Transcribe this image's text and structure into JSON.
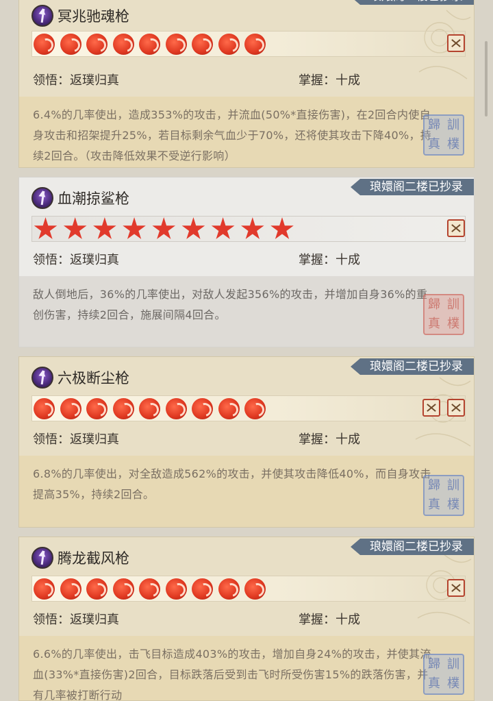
{
  "common": {
    "tag": "琅嬛阁二楼已抄录",
    "comprehension_label": "领悟：",
    "comprehension_value": "返璞归真",
    "mastery_label": "掌握：",
    "mastery_value": "十成",
    "seal_chars": [
      "歸",
      "訓",
      "真",
      "樸"
    ]
  },
  "skills": [
    {
      "name": "冥兆驰魂枪",
      "mark_type": "flame",
      "rating": 9,
      "description": "6.4%的几率使出，造成353%的攻击，并流血(50%*直接伤害)，在2回合内使自身攻击和招架提升25%，若目标剩余气血少于70%，还将使其攻击下降40%，持续2回合。（攻击降低效果不受逆行影响）"
    },
    {
      "name": "血潮掠鲨枪",
      "mark_type": "star",
      "rating": 9,
      "description": "敌人倒地后，36%的几率使出，对敌人发起356%的攻击，并增加自身36%的重创伤害，持续2回合，施展间隔4回合。"
    },
    {
      "name": "六极断尘枪",
      "mark_type": "flame",
      "rating": 9,
      "description": "6.8%的几率使出，对全敌造成562%的攻击，并使其攻击降低40%，而自身攻击提高35%，持续2回合。"
    },
    {
      "name": "腾龙截风枪",
      "mark_type": "flame",
      "rating": 9,
      "description": "6.6%的几率使出，击飞目标造成403%的攻击，增加自身24%的攻击，并使其流血(33%*直接伤害)2回合，目标跌落后受到击飞时所受伤害15%的跌落伤害，并有几率被打断行动"
    }
  ],
  "colors": {
    "tag_bg": "#5f7185",
    "mark_red": "#e13a2c",
    "card_bg": "#e8dfc6",
    "desc_bg": "#e7d9b4",
    "selected_bg": "#ecebe8"
  }
}
